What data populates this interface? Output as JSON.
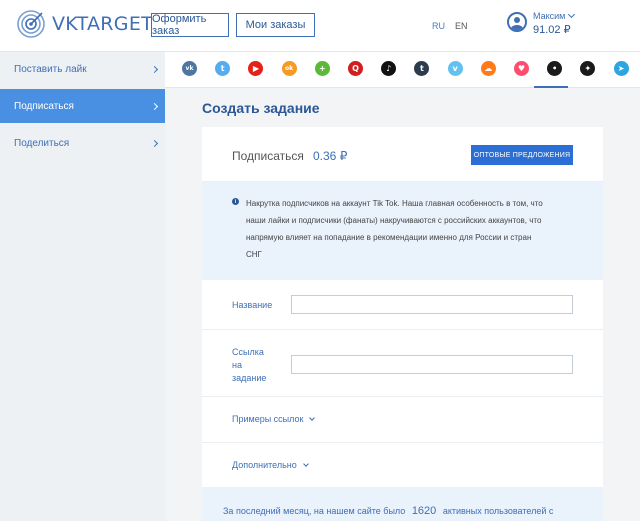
{
  "header": {
    "logo_text": "VKTARGET",
    "order_button": "Оформить заказ",
    "my_orders_button": "Мои заказы",
    "lang_ru": "RU",
    "lang_en": "EN",
    "user_name": "Максим",
    "balance": "91.02 ₽"
  },
  "sidebar": {
    "items": [
      {
        "label": "Поставить лайк",
        "active": false
      },
      {
        "label": "Подписаться",
        "active": true
      },
      {
        "label": "Поделиться",
        "active": false
      }
    ]
  },
  "social": {
    "icons": [
      {
        "name": "vk-icon",
        "glyph": "vk",
        "color": "#4d76a1"
      },
      {
        "name": "twitter-icon",
        "glyph": "t",
        "color": "#55acee"
      },
      {
        "name": "youtube-icon",
        "glyph": "▶",
        "color": "#e62117"
      },
      {
        "name": "odnoklassniki-icon",
        "glyph": "ok",
        "color": "#f59a22"
      },
      {
        "name": "green-plus-icon",
        "glyph": "+",
        "color": "#5cb838"
      },
      {
        "name": "quora-icon",
        "glyph": "Q",
        "color": "#d11e1e"
      },
      {
        "name": "tiktok-icon",
        "glyph": "♪",
        "color": "#111111"
      },
      {
        "name": "tumblr-icon",
        "glyph": "t",
        "color": "#2c3c4f"
      },
      {
        "name": "vimeo-icon",
        "glyph": "v",
        "color": "#62c2ef"
      },
      {
        "name": "soundcloud-icon",
        "glyph": "☁",
        "color": "#ff7a1a"
      },
      {
        "name": "likee-icon",
        "glyph": "♥",
        "color": "#ff4d6d"
      },
      {
        "name": "reddit-icon",
        "glyph": "•",
        "color": "#1a1a1a"
      },
      {
        "name": "yandex-zen-icon",
        "glyph": "✦",
        "color": "#1a1a1a"
      },
      {
        "name": "telegram-icon",
        "glyph": "➤",
        "color": "#2ca5e0"
      }
    ]
  },
  "main": {
    "title": "Создать задание",
    "task_name": "Подписаться",
    "task_price": "0.36 ₽",
    "wholesale_button": "ОПТОВЫЕ ПРЕДЛОЖЕНИЯ",
    "info_line1": "Накрутка подписчиков на аккаунт Tik Tok. Наша главная особенность в том, что",
    "info_line2": "наши лайки и подписчики (фанаты) накручиваются с российских аккаунтов, что",
    "info_line3": "напрямую влияет на попадание в рекомендации именно для России и стран",
    "info_line4": "СНГ",
    "name_label": "Название",
    "name_value": "",
    "link_label_1": "Ссылка",
    "link_label_2": "на",
    "link_label_3": "задание",
    "link_value": "",
    "examples_link": "Примеры ссылок",
    "additional_link": "Дополнительно",
    "stat_prefix": "За последний месяц, на нашем сайте было",
    "stat_number": "1620",
    "stat_suffix": "активных пользователей с"
  },
  "colors": {
    "brand": "#3f6fb5",
    "active_sidebar": "#4a90e2",
    "primary_button": "#2b6fd6"
  }
}
